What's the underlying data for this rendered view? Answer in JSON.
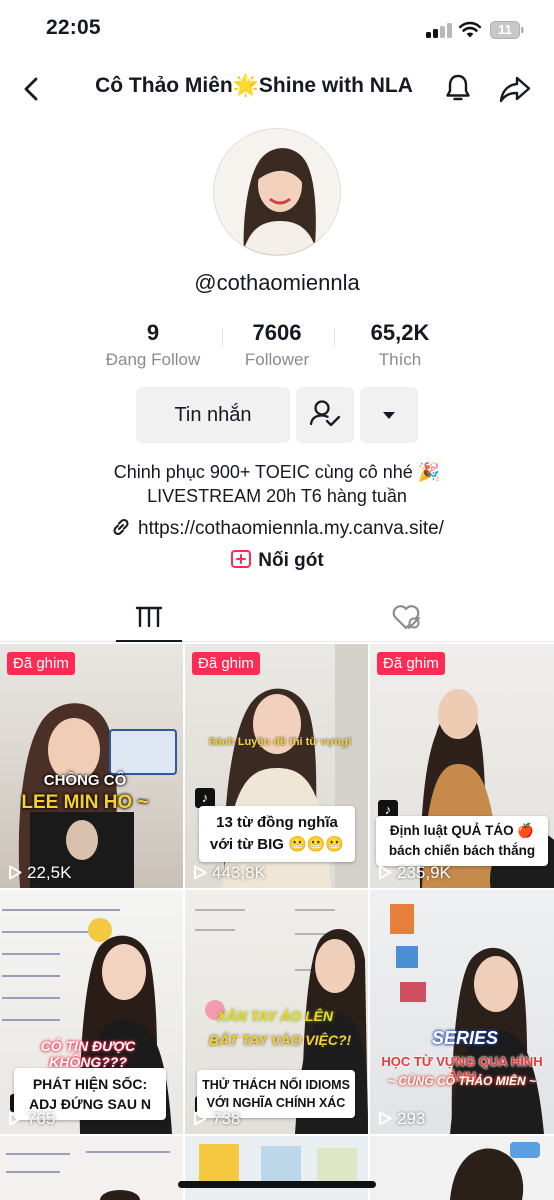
{
  "status_bar": {
    "time": "22:05",
    "battery": "11"
  },
  "header": {
    "title": "Cô Thảo Miên🌟Shine with NLA"
  },
  "profile": {
    "username": "@cothaomiennla",
    "stats": [
      {
        "value": "9",
        "label": "Đang Follow"
      },
      {
        "value": "7606",
        "label": "Follower"
      },
      {
        "value": "65,2K",
        "label": "Thích"
      }
    ],
    "message_button": "Tin nhắn",
    "bio_line1": "Chinh phục 900+ TOEIC cùng cô nhé 🎉",
    "bio_line2": "LIVESTREAM 20h T6 hàng tuần",
    "link": "https://cothaomiennla.my.canva.site/",
    "duet_label": "Nối gót"
  },
  "videos": [
    {
      "pinned": "Đã ghim",
      "views": "22,5K",
      "overlay1": "CHỒNG CÔ",
      "overlay2": "LEE MIN HO ~",
      "caption": ""
    },
    {
      "pinned": "Đã ghim",
      "views": "443,8K",
      "overlay1": "Sách Luyện đề thi từ vựng!",
      "caption": "13 từ đồng nghĩa với từ BIG 😬😬😬"
    },
    {
      "pinned": "Đã ghim",
      "views": "235,9K",
      "caption": "Định luật QUẢ TÁO 🍎 bách chiến bách thắng"
    },
    {
      "pinned": "",
      "views": "765",
      "overlay1": "CÓ TIN ĐƯỢC KHÔNG???",
      "caption": "PHÁT HIỆN SỐC: ADJ ĐỨNG SAU N"
    },
    {
      "pinned": "",
      "views": "738",
      "overlay1": "XẮN TAY ÁO LÊN",
      "overlay2": "BẮT TAY VÀO VIỆC?!",
      "caption": "THỬ THÁCH NỐI IDIOMS VỚI NGHĨA CHÍNH XÁC"
    },
    {
      "pinned": "",
      "views": "293",
      "overlay1": "SERIES",
      "overlay2": "HỌC TỪ VỰNG QUA HÌNH ẢNH",
      "overlay3": "~ CÙNG CÔ THẢO MIÊN ~",
      "caption": ""
    }
  ],
  "colors": {
    "accent": "#fe2c55",
    "text": "#161823",
    "muted": "#8a8b91",
    "button_bg": "#f1f1f2"
  }
}
